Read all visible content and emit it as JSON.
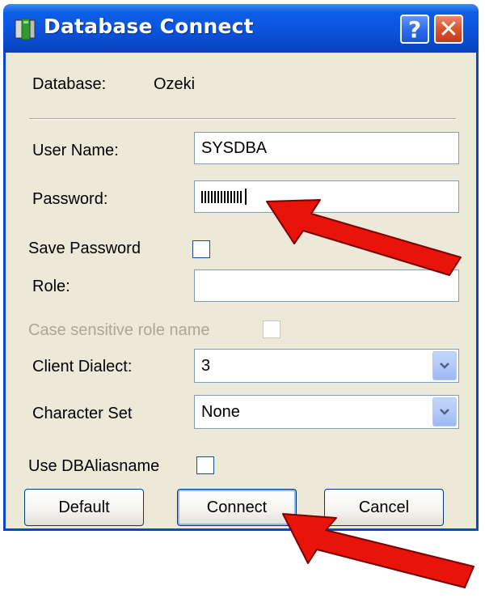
{
  "window": {
    "title": "Database Connect",
    "help_glyph": "?",
    "close_glyph": "✕"
  },
  "database": {
    "label": "Database:",
    "value": "Ozeki"
  },
  "fields": {
    "username_label": "User Name:",
    "username_value": "SYSDBA",
    "password_label": "Password:",
    "save_password_label": "Save Password",
    "role_label": "Role:",
    "role_value": "",
    "case_sensitive_label": "Case sensitive role name",
    "client_dialect_label": "Client Dialect:",
    "client_dialect_value": "3",
    "charset_label": "Character Set",
    "charset_value": "None",
    "use_alias_label": "Use DBAliasname"
  },
  "buttons": {
    "default_label": "Default",
    "connect_label": "Connect",
    "cancel_label": "Cancel"
  },
  "colors": {
    "titlebar": "#0a53dd",
    "dialog_bg": "#ece9d8",
    "arrow": "#e8140a"
  },
  "icons": {
    "app": "database-app-icon",
    "dropdown": "chevron-down-icon",
    "annotation": "red-arrow-icon"
  }
}
